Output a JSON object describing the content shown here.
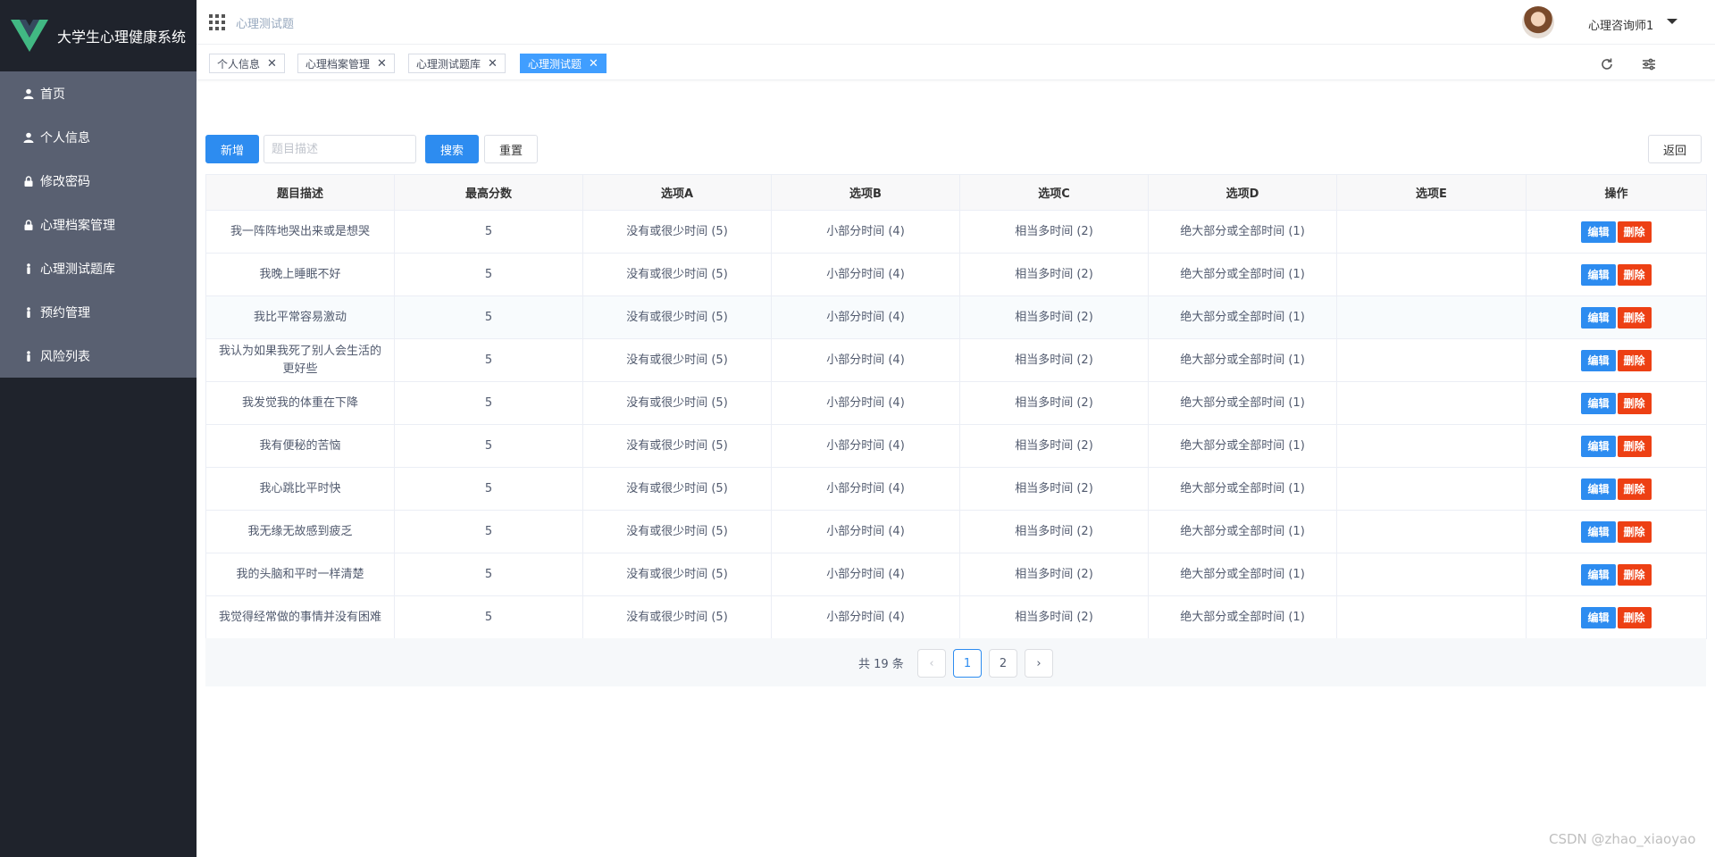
{
  "app": {
    "title": "大学生心理健康系统"
  },
  "sidebar": {
    "items": [
      {
        "label": "首页",
        "icon": "user-icon"
      },
      {
        "label": "个人信息",
        "icon": "user-icon"
      },
      {
        "label": "修改密码",
        "icon": "lock-icon"
      },
      {
        "label": "心理档案管理",
        "icon": "lock-icon"
      },
      {
        "label": "心理测试题库",
        "icon": "person-icon"
      },
      {
        "label": "预约管理",
        "icon": "person-icon"
      },
      {
        "label": "风险列表",
        "icon": "person-icon"
      }
    ]
  },
  "header": {
    "page_title": "心理测试题",
    "user_name": "心理咨询师1"
  },
  "tags": [
    {
      "label": "个人信息",
      "active": false
    },
    {
      "label": "心理档案管理",
      "active": false
    },
    {
      "label": "心理测试题库",
      "active": false
    },
    {
      "label": "心理测试题",
      "active": true
    }
  ],
  "toolbar": {
    "add_label": "新增",
    "search_placeholder": "题目描述",
    "search_label": "搜索",
    "reset_label": "重置",
    "back_label": "返回"
  },
  "table": {
    "columns": [
      "题目描述",
      "最高分数",
      "选项A",
      "选项B",
      "选项C",
      "选项D",
      "选项E",
      "操作"
    ],
    "edit_label": "编辑",
    "delete_label": "删除",
    "rows": [
      [
        "我一阵阵地哭出来或是想哭",
        "5",
        "没有或很少时间 (5)",
        "小部分时间 (4)",
        "相当多时间 (2)",
        "绝大部分或全部时间 (1)",
        ""
      ],
      [
        "我晚上睡眠不好",
        "5",
        "没有或很少时间 (5)",
        "小部分时间 (4)",
        "相当多时间 (2)",
        "绝大部分或全部时间 (1)",
        ""
      ],
      [
        "我比平常容易激动",
        "5",
        "没有或很少时间 (5)",
        "小部分时间 (4)",
        "相当多时间 (2)",
        "绝大部分或全部时间 (1)",
        ""
      ],
      [
        "我认为如果我死了别人会生活的更好些",
        "5",
        "没有或很少时间 (5)",
        "小部分时间 (4)",
        "相当多时间 (2)",
        "绝大部分或全部时间 (1)",
        ""
      ],
      [
        "我发觉我的体重在下降",
        "5",
        "没有或很少时间 (5)",
        "小部分时间 (4)",
        "相当多时间 (2)",
        "绝大部分或全部时间 (1)",
        ""
      ],
      [
        "我有便秘的苦恼",
        "5",
        "没有或很少时间 (5)",
        "小部分时间 (4)",
        "相当多时间 (2)",
        "绝大部分或全部时间 (1)",
        ""
      ],
      [
        "我心跳比平时快",
        "5",
        "没有或很少时间 (5)",
        "小部分时间 (4)",
        "相当多时间 (2)",
        "绝大部分或全部时间 (1)",
        ""
      ],
      [
        "我无缘无故感到疲乏",
        "5",
        "没有或很少时间 (5)",
        "小部分时间 (4)",
        "相当多时间 (2)",
        "绝大部分或全部时间 (1)",
        ""
      ],
      [
        "我的头脑和平时一样清楚",
        "5",
        "没有或很少时间 (5)",
        "小部分时间 (4)",
        "相当多时间 (2)",
        "绝大部分或全部时间 (1)",
        ""
      ],
      [
        "我觉得经常做的事情并没有困难",
        "5",
        "没有或很少时间 (5)",
        "小部分时间 (4)",
        "相当多时间 (2)",
        "绝大部分或全部时间 (1)",
        ""
      ]
    ]
  },
  "pagination": {
    "total_text": "共 19 条",
    "pages": [
      "1",
      "2"
    ],
    "current": "1",
    "prev": "‹",
    "next": "›"
  },
  "watermark": "CSDN @zhao_xiaoyao",
  "colors": {
    "sidebar_bg": "#1f232c",
    "menu_bg": "#596071",
    "primary": "#2d8cf0",
    "danger": "#ed4014",
    "logo_green": "#41b883",
    "logo_dark": "#35495e"
  }
}
